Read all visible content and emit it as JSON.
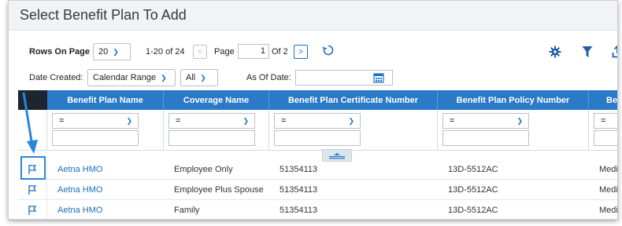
{
  "title": "Select Benefit Plan To Add",
  "toolbar": {
    "rows_label": "Rows On Page",
    "rows_value": "20",
    "range_text": "1-20 of 24",
    "page_label": "Page",
    "page_value": "1",
    "of_pages": "Of 2",
    "settings_icon": "gear-icon",
    "filter_icon": "funnel-icon",
    "refresh_icon": "refresh-icon"
  },
  "filters": {
    "date_created_label": "Date Created:",
    "date_range_value": "Calendar Range",
    "all_value": "All",
    "as_of_label": "As Of Date:",
    "as_of_value": ""
  },
  "columns": [
    "Benefit Plan Name",
    "Coverage Name",
    "Benefit Plan Certificate Number",
    "Benefit Plan Policy Number",
    "Ber"
  ],
  "filter_operator": "=",
  "rows": [
    {
      "plan": "Aetna HMO",
      "coverage": "Employee Only",
      "cert": "51354113",
      "policy": "13D-5512AC",
      "extra": "Medic"
    },
    {
      "plan": "Aetna HMO",
      "coverage": "Employee Plus Spouse",
      "cert": "51354113",
      "policy": "13D-5512AC",
      "extra": "Medic"
    },
    {
      "plan": "Aetna HMO",
      "coverage": "Family",
      "cert": "51354113",
      "policy": "13D-5512AC",
      "extra": "Medic"
    }
  ],
  "colors": {
    "header_blue": "#2a7ac8",
    "link_blue": "#1f6fb5",
    "highlight_blue": "#2b86d6"
  }
}
